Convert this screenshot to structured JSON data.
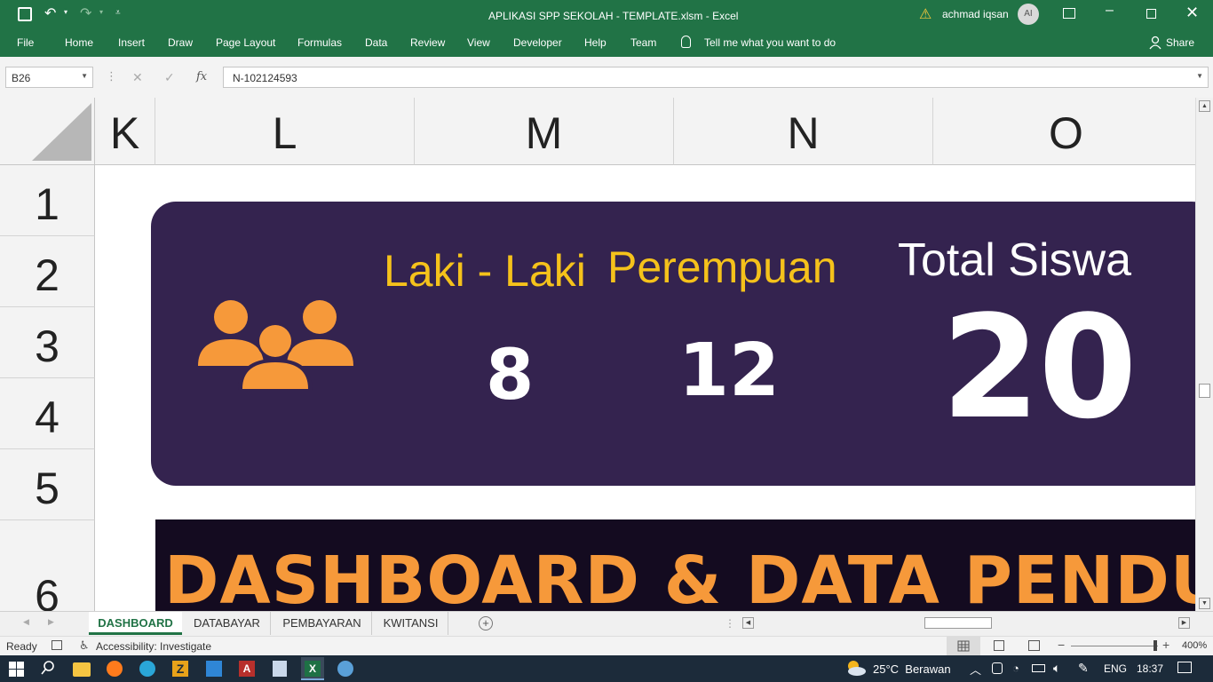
{
  "titlebar": {
    "title": "APLIKASI SPP SEKOLAH - TEMPLATE.xlsm  -  Excel",
    "user": "achmad iqsan",
    "avatar_initials": "AI"
  },
  "menu": {
    "file": "File",
    "home": "Home",
    "insert": "Insert",
    "draw": "Draw",
    "page_layout": "Page Layout",
    "formulas": "Formulas",
    "data": "Data",
    "review": "Review",
    "view": "View",
    "developer": "Developer",
    "help": "Help",
    "team": "Team",
    "tell_me": "Tell me what you want to do",
    "share": "Share"
  },
  "formula_bar": {
    "name_box": "B26",
    "fx": "fx",
    "value": "N-102124593"
  },
  "columns": [
    "K",
    "L",
    "M",
    "N",
    "O"
  ],
  "rows": [
    "1",
    "2",
    "3",
    "4",
    "5",
    "6"
  ],
  "dashboard": {
    "male_label": "Laki - Laki",
    "female_label": "Perempuan",
    "total_label": "Total Siswa",
    "male_count": "8",
    "female_count": "12",
    "total_count": "20",
    "banner_text": "DASHBOARD & DATA PENDUKUNG",
    "colors": {
      "card": "#34234f",
      "accent": "#f5c21b",
      "icon": "#f6993a",
      "banner_bg": "#140b20",
      "banner_text": "#f6993a"
    }
  },
  "sheet_tabs": [
    "DASHBOARD",
    "DATABAYAR",
    "PEMBAYARAN",
    "KWITANSI"
  ],
  "active_tab": "DASHBOARD",
  "status": {
    "ready": "Ready",
    "accessibility": "Accessibility: Investigate",
    "zoom": "400%"
  },
  "taskbar": {
    "weather": "25°C  Berawan",
    "language": "ENG",
    "time": "18:37"
  }
}
